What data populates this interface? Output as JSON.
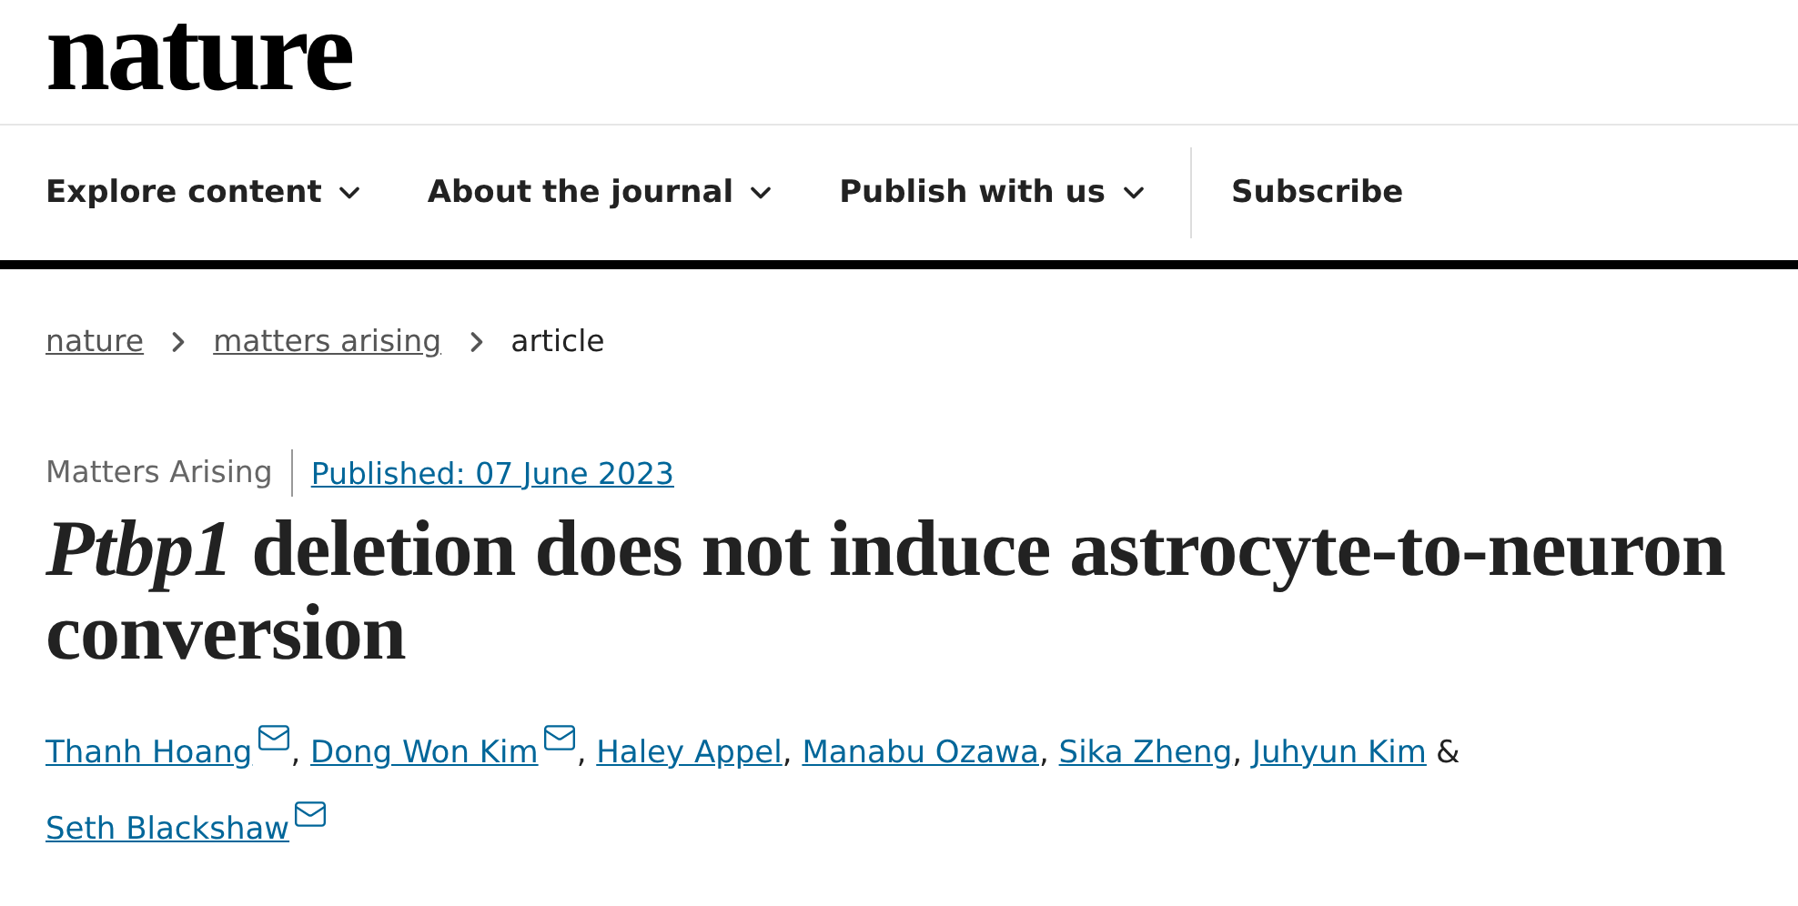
{
  "logo": "nature",
  "nav": [
    {
      "label": "Explore content",
      "dropdown": true
    },
    {
      "label": "About the journal",
      "dropdown": true
    },
    {
      "label": "Publish with us",
      "dropdown": true
    },
    {
      "label": "Subscribe",
      "dropdown": false
    }
  ],
  "breadcrumbs": [
    {
      "label": "nature",
      "link": true
    },
    {
      "label": "matters arising",
      "link": true
    },
    {
      "label": "article",
      "link": false
    }
  ],
  "article_type": "Matters Arising",
  "published": "Published: 07 June 2023",
  "title": "*Ptbp1* deletion does not induce astrocyte-to-neuron conversion",
  "authors": [
    {
      "name": "Thanh Hoang",
      "email": true,
      "separator": ","
    },
    {
      "name": "Dong Won Kim",
      "email": true,
      "separator": ","
    },
    {
      "name": "Haley Appel",
      "email": false,
      "separator": ","
    },
    {
      "name": "Manabu Ozawa",
      "email": false,
      "separator": ","
    },
    {
      "name": "Sika Zheng",
      "email": false,
      "separator": ","
    },
    {
      "name": "Juhyun Kim",
      "email": false,
      "separator": "&",
      "separator_spaced": true
    },
    {
      "name": "Seth Blackshaw",
      "email": true
    }
  ]
}
